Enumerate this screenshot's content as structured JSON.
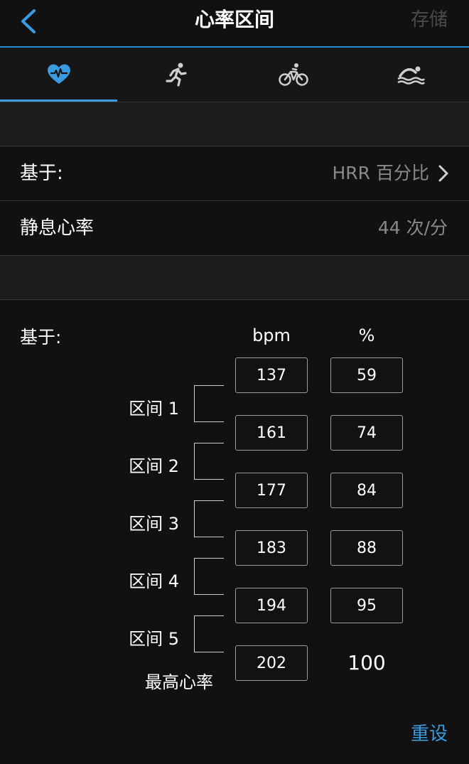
{
  "header": {
    "title": "心率区间",
    "save_label": "存储"
  },
  "tabs": [
    {
      "icon": "heart-icon",
      "active": true
    },
    {
      "icon": "running-icon",
      "active": false
    },
    {
      "icon": "cycling-icon",
      "active": false
    },
    {
      "icon": "swimming-icon",
      "active": false
    }
  ],
  "settings": {
    "based_on_label": "基于:",
    "based_on_value": "HRR 百分比",
    "resting_hr_label": "静息心率",
    "resting_hr_value": "44 次/分"
  },
  "zones": {
    "based_on_label": "基于:",
    "bpm_header": "bpm",
    "percent_header": "%",
    "rows": [
      {
        "bpm": "137",
        "pct": "59"
      },
      {
        "bpm": "161",
        "pct": "74"
      },
      {
        "bpm": "177",
        "pct": "84"
      },
      {
        "bpm": "183",
        "pct": "88"
      },
      {
        "bpm": "194",
        "pct": "95"
      },
      {
        "bpm": "202",
        "pct": "100"
      }
    ],
    "zone_labels": [
      "区间 1",
      "区间 2",
      "区间 3",
      "区间 4",
      "区间 5"
    ],
    "max_hr_label": "最高心率"
  },
  "footer": {
    "reset_label": "重设"
  },
  "colors": {
    "accent": "#3b9be0",
    "background": "#121212"
  }
}
